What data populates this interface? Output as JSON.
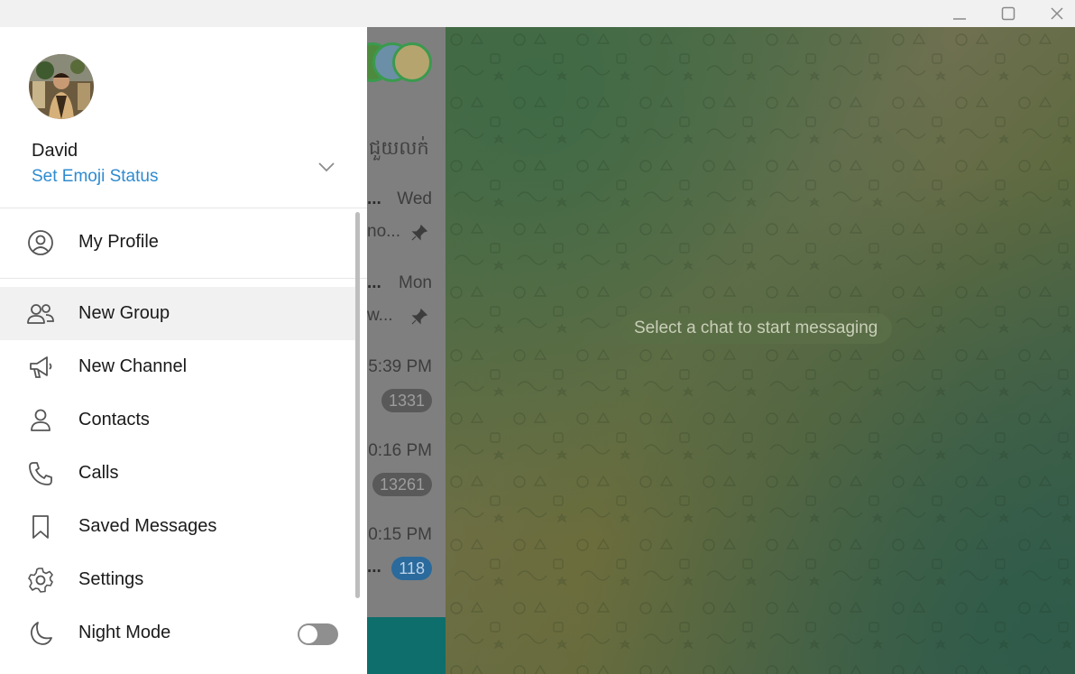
{
  "window": {
    "minimize_icon": "minimize-icon",
    "maximize_icon": "maximize-icon",
    "close_icon": "close-icon"
  },
  "drawer": {
    "user_name": "David",
    "emoji_status": "Set Emoji Status",
    "menu": [
      {
        "label": "My Profile",
        "icon": "user-circle-icon"
      },
      {
        "label": "New Group",
        "icon": "users-icon"
      },
      {
        "label": "New Channel",
        "icon": "megaphone-icon"
      },
      {
        "label": "Contacts",
        "icon": "person-icon"
      },
      {
        "label": "Calls",
        "icon": "phone-icon"
      },
      {
        "label": "Saved Messages",
        "icon": "bookmark-icon"
      },
      {
        "label": "Settings",
        "icon": "gear-icon"
      },
      {
        "label": "Night Mode",
        "icon": "moon-icon",
        "toggle_on": false
      }
    ]
  },
  "chat_list": {
    "header_fragment": "ជួយលក់",
    "rows": [
      {
        "prefix": "...",
        "time": "Wed",
        "preview": "no...",
        "pinned": true
      },
      {
        "prefix": "...",
        "time": "Mon",
        "preview": "w...",
        "pinned": true
      },
      {
        "time": "5:39 PM",
        "badge": "1331"
      },
      {
        "time": "0:16 PM",
        "badge": "13261"
      },
      {
        "prefix": "...",
        "time": "0:15 PM",
        "badge": "118"
      }
    ]
  },
  "chat_pane": {
    "empty_message": "Select a chat to start messaging"
  },
  "colors": {
    "accent": "#2e8bd0",
    "unread_badge_blue": "#2a6a9c",
    "footer_teal": "#0e6e6b"
  }
}
